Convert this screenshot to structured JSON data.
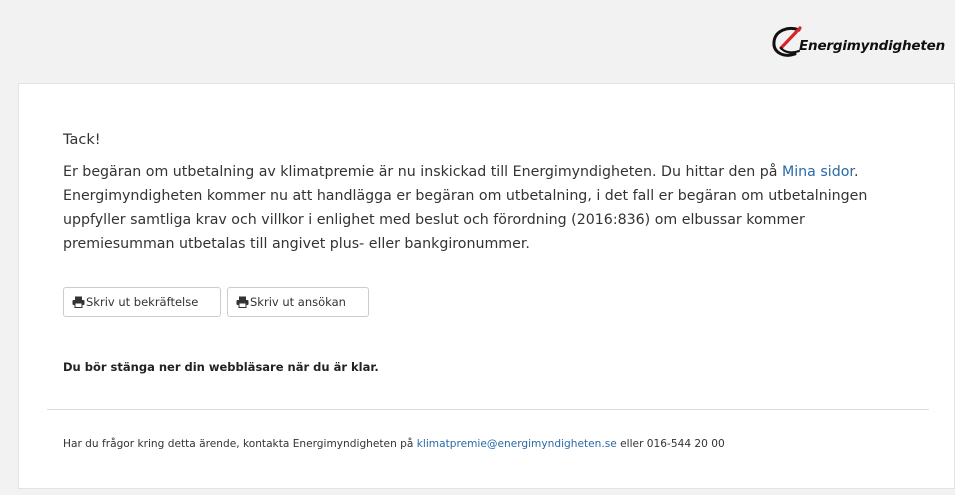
{
  "header": {
    "logo_text": "Energimyndigheten",
    "logo_accent_color": "#d8232a"
  },
  "main": {
    "heading": "Tack!",
    "message_part1": "Er begäran om utbetalning av klimatpremie är nu inskickad till Energimyndigheten. Du hittar den på ",
    "mina_sidor_link": "Mina sidor",
    "message_part2": ". Energimyndigheten kommer nu att handlägga er begäran om utbetalning, i det fall er begäran om utbetalningen uppfyller samtliga krav och villkor i enlighet med beslut och förordning (2016:836) om elbussar kommer premiesumman utbetalas till angivet plus- eller bankgironummer.",
    "buttons": {
      "print_confirmation": "Skriv ut bekräftelse",
      "print_application": "Skriv ut ansökan",
      "icon": "print-icon"
    },
    "close_browser_note": "Du bör stänga ner din webbläsare när du är klar."
  },
  "footer": {
    "text_before": "Har du frågor kring detta ärende, kontakta Energimyndigheten på ",
    "email_link": "klimatpremie@energimyndigheten.se",
    "text_after": " eller 016-544 20 00"
  },
  "colors": {
    "link": "#2a6aa8",
    "header_bg": "#f2f2f2"
  }
}
